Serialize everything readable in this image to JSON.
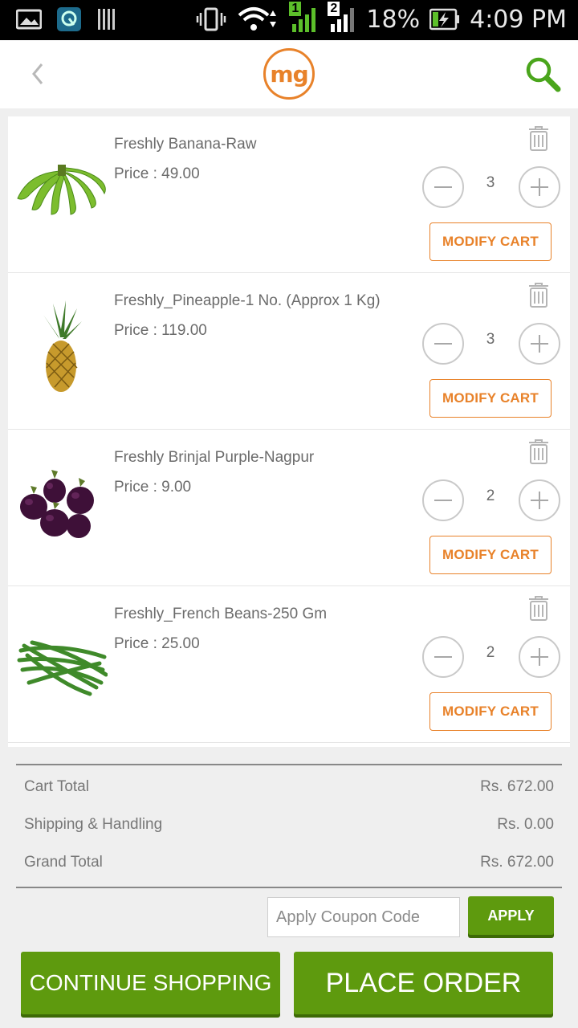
{
  "status_bar": {
    "battery_percent": "18%",
    "time": "4:09 PM",
    "sim1_label": "1",
    "sim2_label": "2"
  },
  "header": {
    "logo_text": "mg",
    "back_icon": "chevron-left-icon",
    "search_icon": "search-icon"
  },
  "cart": {
    "items": [
      {
        "name": "Freshly Banana-Raw",
        "price": "Price : 49.00",
        "quantity": "3",
        "modify_label": "MODIFY CART"
      },
      {
        "name": "Freshly_Pineapple-1 No. (Approx 1 Kg)",
        "price": "Price : 119.00",
        "quantity": "3",
        "modify_label": "MODIFY CART"
      },
      {
        "name": "Freshly Brinjal Purple-Nagpur",
        "price": "Price : 9.00",
        "quantity": "2",
        "modify_label": "MODIFY CART"
      },
      {
        "name": "Freshly_French Beans-250 Gm",
        "price": "Price : 25.00",
        "quantity": "2",
        "modify_label": "MODIFY CART"
      }
    ]
  },
  "totals": {
    "cart_total_label": "Cart Total",
    "cart_total_value": "Rs. 672.00",
    "shipping_label": "Shipping & Handling",
    "shipping_value": "Rs. 0.00",
    "grand_total_label": "Grand Total",
    "grand_total_value": "Rs. 672.00"
  },
  "coupon": {
    "placeholder": "Apply Coupon Code",
    "apply_label": "APPLY"
  },
  "actions": {
    "continue_label": "CONTINUE SHOPPING",
    "place_order_label": "PLACE ORDER"
  },
  "colors": {
    "accent_orange": "#e8822a",
    "accent_green": "#5e9a0e"
  }
}
